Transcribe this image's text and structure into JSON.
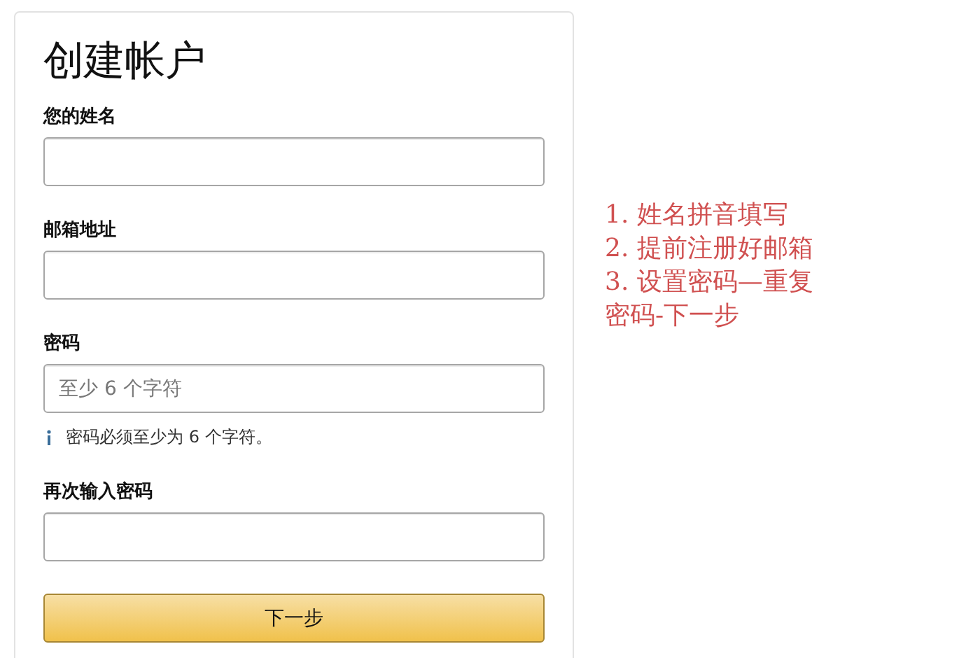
{
  "form": {
    "title": "创建帐户",
    "fields": [
      {
        "label": "您的姓名"
      },
      {
        "label": "邮箱地址"
      },
      {
        "label": "密码",
        "placeholder": "至少 6 个字符",
        "hint": "密码必须至少为 6 个字符。"
      },
      {
        "label": "再次输入密码"
      }
    ],
    "submit": "下一步"
  },
  "annotation": {
    "lines": [
      "1. 姓名拼音填写",
      "2. 提前注册好邮箱",
      "3. 设置密码—重复",
      "密码-下一步"
    ]
  }
}
